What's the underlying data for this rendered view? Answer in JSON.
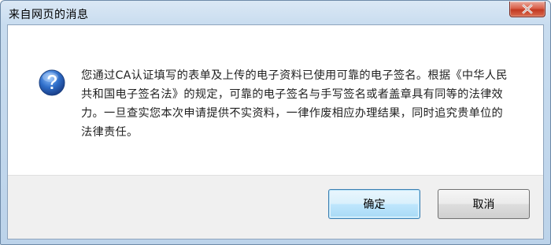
{
  "window": {
    "title": "来自网页的消息"
  },
  "dialog": {
    "icon": "question-icon",
    "message": "您通过CA认证填写的表单及上传的电子资料已使用可靠的电子签名。根据《中华人民共和国电子签名法》的规定，可靠的电子签名与手写签名或者盖章具有同等的法律效力。一旦查实您本次申请提供不实资料，一律作废相应办理结果，同时追究贵单位的法律责任。"
  },
  "buttons": {
    "ok_label": "确定",
    "cancel_label": "取消"
  },
  "colors": {
    "frame": "#bcd3ea",
    "close_button": "#c23a22",
    "question_icon": "#2a5fb0",
    "default_button_border": "#3c7fb1"
  }
}
